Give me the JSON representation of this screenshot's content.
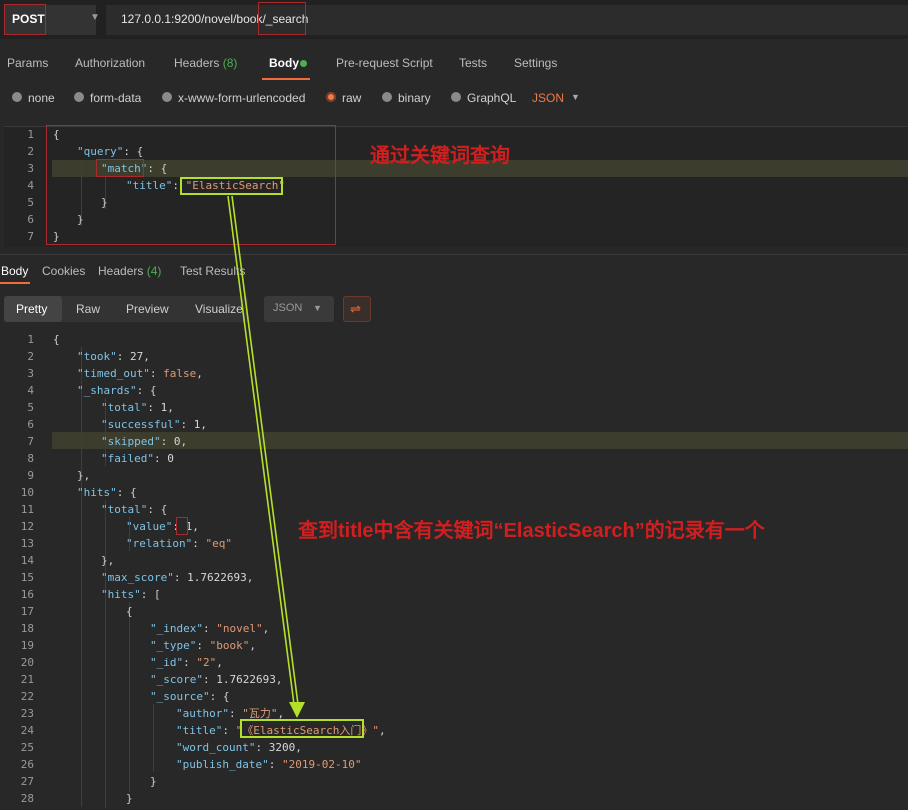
{
  "request": {
    "method": "POST",
    "url": "127.0.0.1:9200/novel/book/_search"
  },
  "request_tabs": [
    {
      "label": "Params"
    },
    {
      "label": "Authorization"
    },
    {
      "label": "Headers",
      "count": "(8)"
    },
    {
      "label": "Body"
    },
    {
      "label": "Pre-request Script"
    },
    {
      "label": "Tests"
    },
    {
      "label": "Settings"
    }
  ],
  "body_types": [
    {
      "label": "none",
      "selected": false
    },
    {
      "label": "form-data",
      "selected": false
    },
    {
      "label": "x-www-form-urlencoded",
      "selected": false
    },
    {
      "label": "raw",
      "selected": true
    },
    {
      "label": "binary",
      "selected": false
    },
    {
      "label": "GraphQL",
      "selected": false
    }
  ],
  "body_format": "JSON",
  "request_body_lines": [
    "1",
    "2",
    "3",
    "4",
    "5",
    "6",
    "7"
  ],
  "request_body": {
    "l1": "{",
    "query_key": "\"query\"",
    "match_key": "\"match\"",
    "title_key": "\"title\"",
    "title_value": "\"ElasticSearch\"",
    "close_inner": "}",
    "close_mid": "}",
    "close_outer": "}"
  },
  "response_tabs": [
    {
      "label": "Body"
    },
    {
      "label": "Cookies"
    },
    {
      "label": "Headers",
      "count": "(4)"
    },
    {
      "label": "Test Results"
    }
  ],
  "view_modes": [
    "Pretty",
    "Raw",
    "Preview",
    "Visualize"
  ],
  "response_format": "JSON",
  "response_body_lines": [
    "1",
    "2",
    "3",
    "4",
    "5",
    "6",
    "7",
    "8",
    "9",
    "10",
    "11",
    "12",
    "13",
    "14",
    "15",
    "16",
    "17",
    "18",
    "19",
    "20",
    "21",
    "22",
    "23",
    "24",
    "25",
    "26",
    "27",
    "28"
  ],
  "response_body": {
    "took": "27",
    "timed_out": "false",
    "shards_total": "1",
    "shards_successful": "1",
    "shards_skipped": "0",
    "shards_failed": "0",
    "hits_total_value": "1",
    "hits_total_relation": "\"eq\"",
    "max_score": "1.7622693",
    "hit_index": "\"novel\"",
    "hit_type": "\"book\"",
    "hit_id": "\"2\"",
    "hit_score": "1.7622693",
    "source_author": "\"瓦力\"",
    "source_title": "《ElasticSearch入门》",
    "source_word_count": "3200",
    "source_publish_date": "\"2019-02-10\""
  },
  "annotations": {
    "query_note": "通过关键词查询",
    "result_note": "查到title中含有关键词“ElasticSearch”的记录有一个"
  },
  "colors": {
    "accent": "#f26b3a",
    "annotation_red": "#d11f1f",
    "highlight_green": "#b4e02a",
    "json_key": "#7ec3e6",
    "json_string": "#e09a74"
  }
}
